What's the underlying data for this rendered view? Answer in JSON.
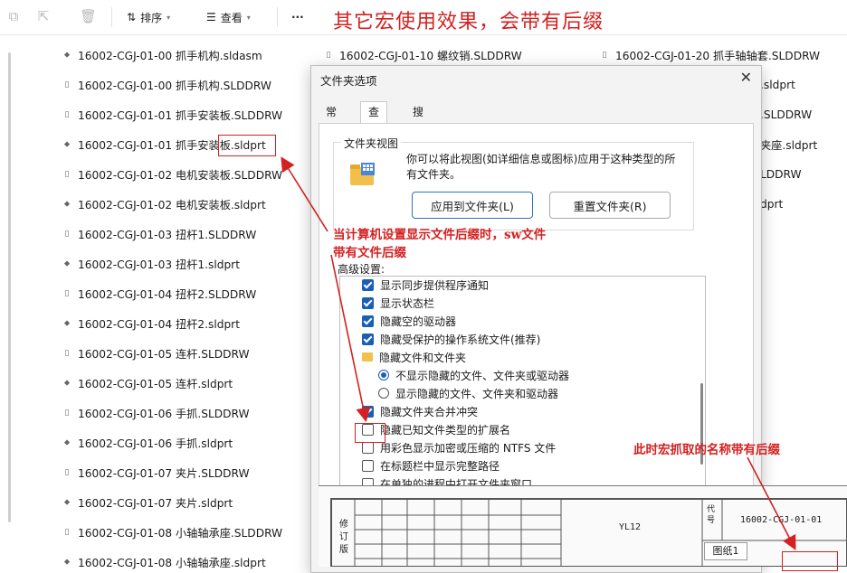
{
  "toolbar": {
    "sort_label": "排序",
    "view_label": "查看",
    "more_label": "···"
  },
  "annotation_title": "其它宏使用效果，会带有后缀",
  "files_left": [
    "16002-CGJ-01-00 抓手机构.sldasm",
    "16002-CGJ-01-00 抓手机构.SLDDRW",
    "16002-CGJ-01-01 抓手安装板.SLDDRW",
    "16002-CGJ-01-01 抓手安装板.sldprt",
    "16002-CGJ-01-02 电机安装板.SLDDRW",
    "16002-CGJ-01-02 电机安装板.sldprt",
    "16002-CGJ-01-03 扭杆1.SLDDRW",
    "16002-CGJ-01-03 扭杆1.sldprt",
    "16002-CGJ-01-04 扭杆2.SLDDRW",
    "16002-CGJ-01-04 扭杆2.sldprt",
    "16002-CGJ-01-05 连杆.SLDDRW",
    "16002-CGJ-01-05 连杆.sldprt",
    "16002-CGJ-01-06 手抓.SLDDRW",
    "16002-CGJ-01-06 手抓.sldprt",
    "16002-CGJ-01-07 夹片.SLDDRW",
    "16002-CGJ-01-07 夹片.sldprt",
    "16002-CGJ-01-08 小轴轴承座.SLDDRW",
    "16002-CGJ-01-08 小轴轴承座.sldprt"
  ],
  "files_middle_top": "16002-CGJ-01-10 螺纹销.SLDDRW",
  "files_right_top": "16002-CGJ-01-20 抓手轴轴套.SLDDRW",
  "files_right_partial": [
    ".sldprt",
    ".SLDDRW",
    "夹座.sldprt",
    "LDDRW",
    "dprt"
  ],
  "dialog": {
    "title": "文件夹选项",
    "tabs": [
      "常规",
      "查看",
      "搜索"
    ],
    "group_label": "文件夹视图",
    "group_desc": "你可以将此视图(如详细信息或图标)应用于这种类型的所有文件夹。",
    "apply_button": "应用到文件夹(L)",
    "reset_button": "重置文件夹(R)",
    "advanced_label": "高级设置:",
    "options": [
      {
        "type": "check",
        "on": true,
        "label": "显示同步提供程序通知"
      },
      {
        "type": "check",
        "on": true,
        "label": "显示状态栏"
      },
      {
        "type": "check",
        "on": true,
        "label": "隐藏空的驱动器"
      },
      {
        "type": "check",
        "on": true,
        "label": "隐藏受保护的操作系统文件(推荐)"
      },
      {
        "type": "folder",
        "on": false,
        "label": "隐藏文件和文件夹"
      },
      {
        "type": "radio",
        "on": true,
        "label": "不显示隐藏的文件、文件夹或驱动器"
      },
      {
        "type": "radio",
        "on": false,
        "label": "显示隐藏的文件、文件夹和驱动器"
      },
      {
        "type": "check",
        "on": true,
        "label": "隐藏文件夹合并冲突"
      },
      {
        "type": "check",
        "on": false,
        "label": "隐藏已知文件类型的扩展名"
      },
      {
        "type": "check",
        "on": false,
        "label": "用彩色显示加密或压缩的 NTFS 文件"
      },
      {
        "type": "check",
        "on": false,
        "label": "在标题栏中显示完整路径"
      },
      {
        "type": "check",
        "on": false,
        "label": "在单独的进程中打开文件夹窗口"
      }
    ]
  },
  "annotations": {
    "ext_line1": "当计算机设置显示文件后缀时，sw文件",
    "ext_line2": "带有文件后缀",
    "macro_note": "此时宏抓取的名称带有后缀"
  },
  "drawing": {
    "side_label": "修订版",
    "title_block_text": "YL12",
    "code_label": "代号",
    "code_value": "16002-CGJ-01-01",
    "sheet_tab": "图纸1"
  },
  "colors": {
    "annotation": "#d42020",
    "accent": "#1a5fb4"
  }
}
